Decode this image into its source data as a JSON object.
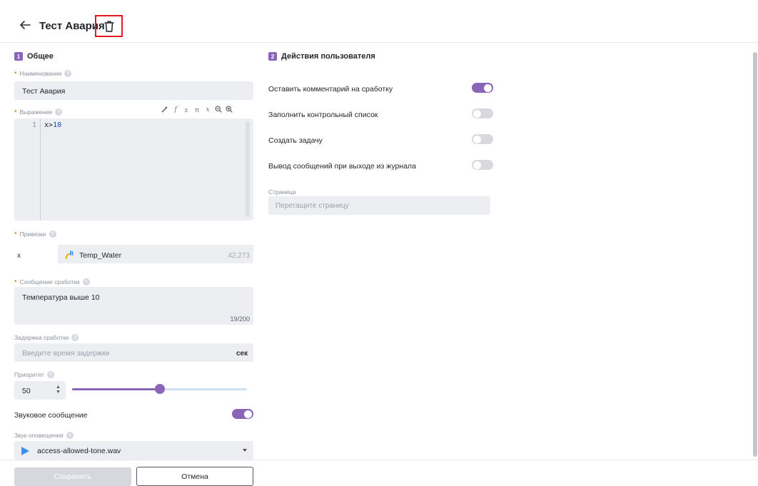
{
  "header": {
    "title": "Тест Авария"
  },
  "general": {
    "number": "1",
    "title": "Общее",
    "name": {
      "label": "Наименование",
      "value": "Тест Авария"
    },
    "expression": {
      "label": "Выражение",
      "line_number": "1",
      "code_var": "x",
      "code_op": ">",
      "code_num": "10",
      "toolbar": [
        "magic-wand",
        "f",
        "±",
        "π",
        "x",
        "zoom-out",
        "zoom-in"
      ]
    },
    "bindings": {
      "label": "Привязки",
      "variable": "x",
      "tag_name": "Temp_Water",
      "tag_value": "42,273"
    },
    "message": {
      "label": "Сообщение сработки",
      "value": "Температура выше 10",
      "counter": "19/200"
    },
    "delay": {
      "label": "Задержка сработки",
      "placeholder": "Введите время задержки",
      "unit": "сек"
    },
    "priority": {
      "label": "Приоритет",
      "value": "50",
      "slider_fraction": 0.5
    },
    "sound_message": {
      "label": "Звуковое сообщение",
      "enabled": true
    },
    "sound": {
      "label": "Звук оповещения",
      "value": "access-allowed-tone.wav"
    }
  },
  "actions": {
    "number": "2",
    "title": "Действия пользователя",
    "toggles": [
      {
        "label": "Оставить комментарий на сработку",
        "enabled": true
      },
      {
        "label": "Заполнить контрольный список",
        "enabled": false
      },
      {
        "label": "Создать задачу",
        "enabled": false
      },
      {
        "label": "Вывод сообщений при выходе из журнала",
        "enabled": false
      }
    ],
    "page": {
      "label": "Страница",
      "placeholder": "Перетащите страницу"
    }
  },
  "footer": {
    "save_label": "Сохранить",
    "cancel_label": "Отмена"
  },
  "colors": {
    "accent": "#8a64b6",
    "highlight_border": "#e3191f",
    "play_icon": "#3b8ef0"
  }
}
